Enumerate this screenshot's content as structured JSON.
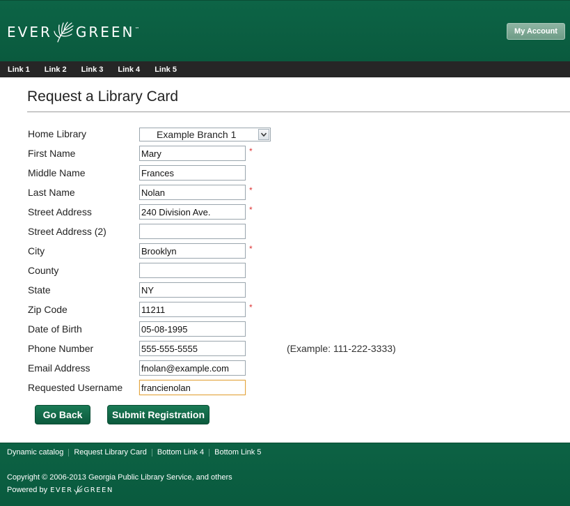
{
  "header": {
    "logo_left": "EVER",
    "logo_right": "GREEN",
    "logo_tm": "™",
    "my_account": "My Account"
  },
  "nav": {
    "links": [
      "Link 1",
      "Link 2",
      "Link 3",
      "Link 4",
      "Link 5"
    ]
  },
  "page": {
    "title": "Request a Library Card"
  },
  "form": {
    "home_library": {
      "label": "Home Library",
      "value": "Example Branch 1"
    },
    "fields": [
      {
        "label": "First Name",
        "value": "Mary",
        "required": true
      },
      {
        "label": "Middle Name",
        "value": "Frances",
        "required": false
      },
      {
        "label": "Last Name",
        "value": "Nolan",
        "required": true
      },
      {
        "label": "Street Address",
        "value": "240 Division Ave.",
        "required": true
      },
      {
        "label": "Street Address (2)",
        "value": "",
        "required": false
      },
      {
        "label": "City",
        "value": "Brooklyn",
        "required": true
      },
      {
        "label": "County",
        "value": "",
        "required": false
      },
      {
        "label": "State",
        "value": "NY",
        "required": false
      },
      {
        "label": "Zip Code",
        "value": "11211",
        "required": true
      },
      {
        "label": "Date of Birth",
        "value": "05-08-1995",
        "required": false
      },
      {
        "label": "Phone Number",
        "value": "555-555-5555",
        "required": false,
        "hint": "(Example: 111-222-3333)"
      },
      {
        "label": "Email Address",
        "value": "fnolan@example.com",
        "required": false
      },
      {
        "label": "Requested Username",
        "value": "francienolan",
        "required": false,
        "focused": true
      }
    ],
    "required_marker": "*",
    "go_back": "Go Back",
    "submit": "Submit Registration"
  },
  "footer": {
    "links": [
      "Dynamic catalog",
      "Request Library Card",
      "Bottom Link 4",
      "Bottom Link 5"
    ],
    "copyright": "Copyright © 2006-2013 Georgia Public Library Service, and others",
    "powered_by": "Powered by",
    "logo_left": "EVER",
    "logo_right": "GREEN"
  },
  "colors": {
    "brand_green": "#0b5e40",
    "nav_dark": "#262626",
    "required_red": "#dd3333",
    "focus_orange": "#e3a540"
  }
}
